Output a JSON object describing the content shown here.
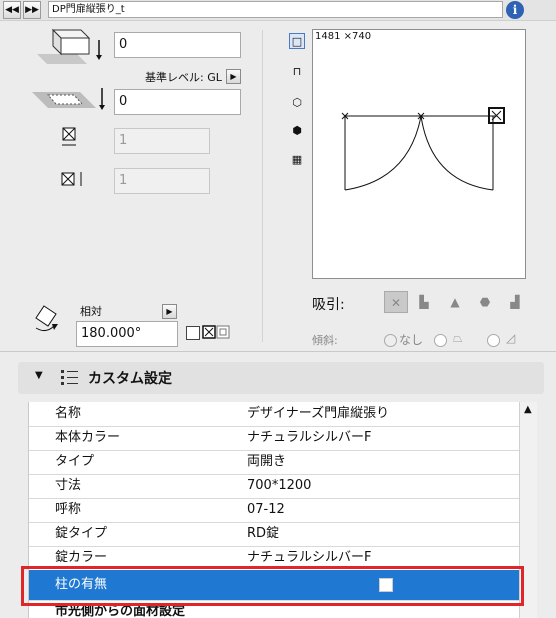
{
  "header": {
    "object_name": "DP門扉縦張り_t"
  },
  "left": {
    "height_value": "0",
    "ref_level_label": "基準レベル: GL",
    "offset_value": "0",
    "width_value": "1",
    "depth_value": "1",
    "angle_label": "相対",
    "angle_value": "180.000°"
  },
  "preview": {
    "size_label": "1481 ×740",
    "snap_label": "吸引:",
    "slope_label": "傾斜:",
    "slope_none_label": "なし"
  },
  "section": {
    "title": "カスタム設定"
  },
  "properties": [
    {
      "key": "名称",
      "value": "デザイナーズ門扉縦張り"
    },
    {
      "key": "本体カラー",
      "value": "ナチュラルシルバーF"
    },
    {
      "key": "タイプ",
      "value": "両開き"
    },
    {
      "key": "寸法",
      "value": "700*1200"
    },
    {
      "key": "呼称",
      "value": "07-12"
    },
    {
      "key": "錠タイプ",
      "value": "RD錠"
    },
    {
      "key": "錠カラー",
      "value": "ナチュラルシルバーF"
    },
    {
      "key": "柱の有無",
      "value": ""
    },
    {
      "key": "市光側からの面材設定",
      "value": ""
    }
  ],
  "highlight": {
    "color": "#e0262b",
    "row_bg": "#1f78d1"
  }
}
